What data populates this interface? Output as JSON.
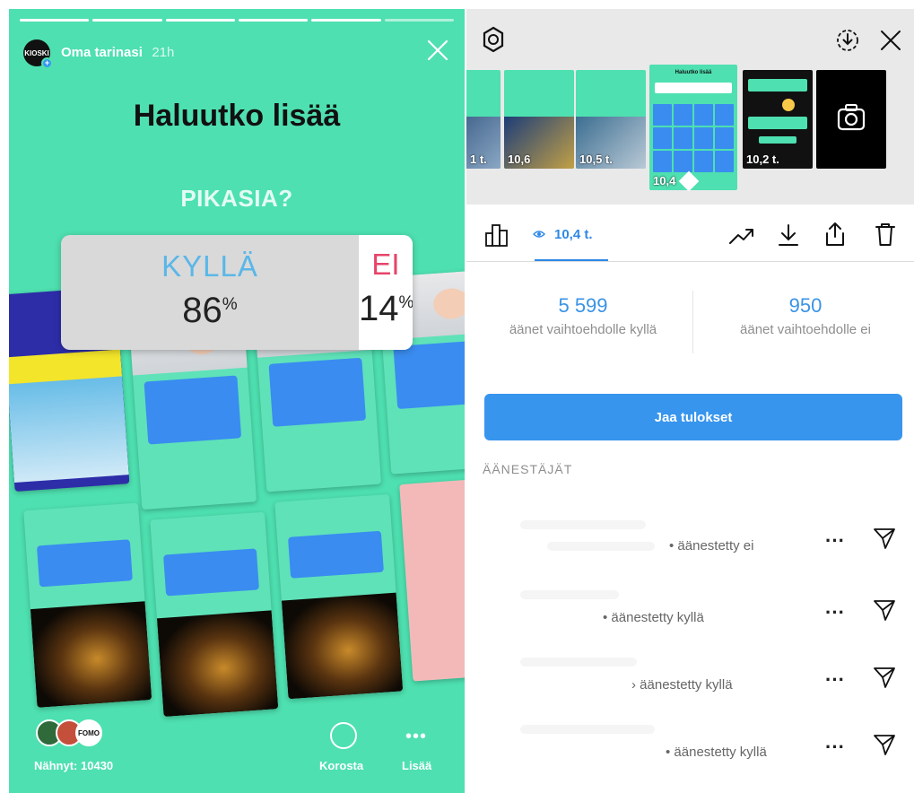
{
  "story": {
    "username": "Oma tarinasi",
    "time": "21h",
    "avatar_text": "KIOSKI",
    "question_line1": "Haluutko lisää",
    "question_line2": "PIKASIA?",
    "poll": {
      "yes_label": "KYLLÄ",
      "yes_percent": "86",
      "no_label": "EI",
      "no_percent": "14",
      "percent_sign": "%",
      "yes_color": "#5ab7e8",
      "no_color": "#e7446a"
    },
    "footer": {
      "fomo_badge": "FOMO",
      "seen": "Nähnyt: 10430",
      "highlight_label": "Korosta",
      "more_label": "Lisää"
    },
    "background_color": "#4ee0b0"
  },
  "insights": {
    "thumbnails": [
      {
        "count": "1 t."
      },
      {
        "count": "10,6"
      },
      {
        "count": "10,5 t."
      },
      {
        "count": "10,4"
      },
      {
        "count": "10,2 t."
      }
    ],
    "views": "10,4 t.",
    "yes_votes": {
      "count": "5 599",
      "label": "äänet vaihtoehdolle kyllä"
    },
    "no_votes": {
      "count": "950",
      "label": "äänet vaihtoehdolle ei"
    },
    "share_button": "Jaa tulokset",
    "voters_title": "ÄÄNESTÄJÄT",
    "voters": [
      {
        "status": "• äänestetty ei"
      },
      {
        "status": "• äänestetty kyllä"
      },
      {
        "status": "› äänestetty kyllä"
      },
      {
        "status": "• äänestetty kyllä"
      }
    ],
    "more_icon": "more-icon",
    "send_icon": "send-icon",
    "accent_color": "#3795ee"
  }
}
